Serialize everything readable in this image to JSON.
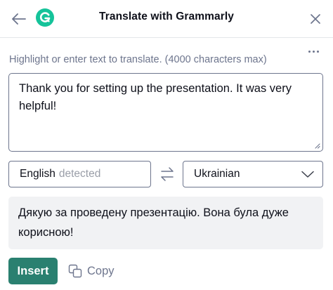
{
  "header": {
    "title": "Translate with Grammarly",
    "back_icon": "arrow-left-icon",
    "logo_icon": "grammarly-logo-icon",
    "close_icon": "close-icon",
    "logo_color": "#15c39a"
  },
  "more_icon": "more-horizontal-icon",
  "instruction": "Highlight or enter text to translate. (4000 characters max)",
  "source_text": "Thank you for setting up the presentation. It was very helpful!",
  "source_language": {
    "label": "English",
    "status": "detected"
  },
  "swap_icon": "swap-arrows-icon",
  "target_language": {
    "selected": "Ukrainian",
    "icon": "chevron-down-icon"
  },
  "translated_text": "Дякую за проведену презентацію. Вона була дуже корисною!",
  "actions": {
    "insert_label": "Insert",
    "copy_label": "Copy",
    "copy_icon": "copy-icon",
    "accent_color": "#2a8070"
  }
}
